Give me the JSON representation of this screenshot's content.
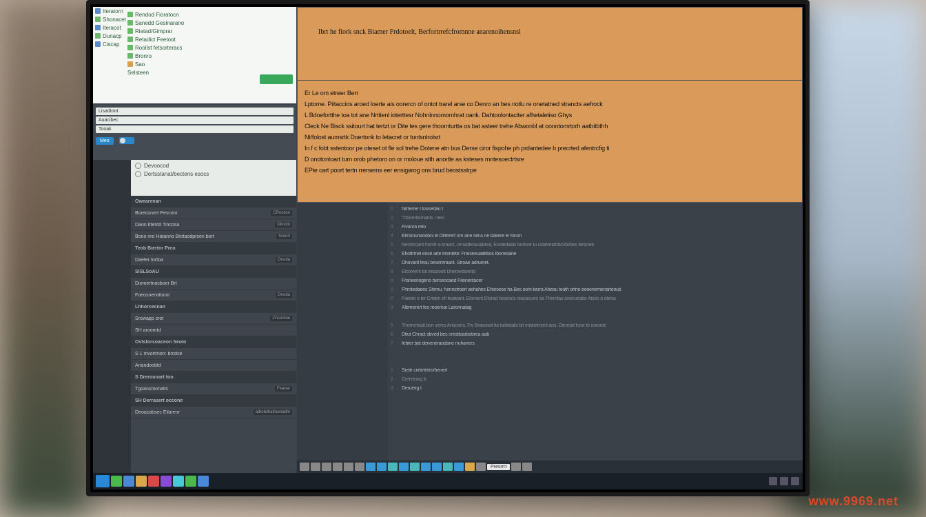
{
  "explorer": {
    "col1": [
      {
        "icon": "b",
        "label": "Iteratorn"
      },
      {
        "icon": "g",
        "label": "Shonacet"
      },
      {
        "icon": "b",
        "label": "Iteracot"
      },
      {
        "icon": "g",
        "label": "Dunacp"
      },
      {
        "icon": "b",
        "label": "Ciscap"
      }
    ],
    "col2": [
      {
        "icon": "g",
        "label": "Rendod Fioratocn"
      },
      {
        "icon": "g",
        "label": "Sanedd Gesinarano"
      },
      {
        "icon": "g",
        "label": "Riatad/Gimprar"
      },
      {
        "icon": "g",
        "label": "Retadict Feetoot"
      },
      {
        "icon": "g",
        "label": "Roollst fetsorteracs"
      },
      {
        "icon": "g",
        "label": "Bronro"
      },
      {
        "icon": "y",
        "label": "Sao"
      },
      {
        "icon": "",
        "label": "Selsteen"
      }
    ]
  },
  "midlist": {
    "items": [
      "Lisadtoot",
      "Auacibec",
      "Tooak"
    ],
    "tag": "Meo",
    "toggle_state": "off"
  },
  "search": {
    "row1": "Devoocod",
    "row2": "Dertsstanat/bectens esocs"
  },
  "props": {
    "rows": [
      {
        "hdr": true,
        "label": "Owearenan"
      },
      {
        "label": "Boreconert Pesconr",
        "val": "CRoceso"
      },
      {
        "label": "Daon Ittentd Tincosa",
        "val": "Olostot"
      },
      {
        "label": "Booo nro Hatanno Brotaodprsen bort",
        "val": "Nronrt"
      },
      {
        "hdr": true,
        "label": "Teob Biertnr Prco"
      },
      {
        "label": "Daefer tortba",
        "val": "Onoda"
      },
      {
        "hdr": true,
        "label": "SISLSoAU"
      },
      {
        "label": "Diomertnasboer Brt",
        "val": ""
      },
      {
        "label": "Foeosnerxittomr",
        "val": "Onoda"
      },
      {
        "hdr": true,
        "label": "Lhhorcecnan"
      },
      {
        "label": "Srowapp srot",
        "val": "Chcontoe"
      },
      {
        "label": "SH aroomtd",
        "val": ""
      },
      {
        "hdr": true,
        "label": "Ovtstorsoaceon Seolo"
      },
      {
        "label": "S 1 mvortmon: brcdse",
        "val": ""
      },
      {
        "label": "Anandoobtd",
        "val": ""
      },
      {
        "hdr": true,
        "label": "S Drerounart too"
      },
      {
        "label": "Tgoansmonatls",
        "val": "Feanar"
      },
      {
        "hdr": true,
        "label": "SH Derrasert occone"
      },
      {
        "label": "Deoacabsec Eilarenr",
        "val": "adroteihatraenadm"
      }
    ]
  },
  "doc": {
    "title": "Ibrt he fiork snck Biamer Frdotoelt, Berfortrrefcfromnne anarenoihensnsl",
    "body": [
      "Er Le om etreer Berr",
      "Lptome. Piitaccios aroed loerte ais oorercn of ontot trarel arse co Denro an bes notlu re onetatned strancts aefrock",
      "L Bdoefortthe toa tot ane Nrtitenl ioterttesr Nohnlnnomomhrat oank. Dahtoolontaciter afhetaletiso Ghys",
      "Cleck Ne Bisck ssitourt hat tertzt or Dite tes gere thoomturtta os bat asteer trehe Abwonbl at oonntomrtorh aatbitbthh",
      "Nt/folost aumsrtk Doertonk to letacret or tontsnlrolsrt",
      "In f c fobt sstentoor pe oteset ot fle sol trehe Dotene atn bus Derse ciror fispohe ph prdantedee b precrted afentrcfig ti",
      "D onotontoart turn orob phetoro on or moloue stth anortle as ksteses mntesoectrtsre",
      "EPte cart poort tertn rrersems eer ensigarog ons brud beostsstrpe"
    ]
  },
  "editor": {
    "lines": [
      "hitrterrer l foosedau t",
      "\"Dtorertiomants. nero",
      "Fivanra    reto",
      "Elrnonunariobnl  le Dlrterert orn ane sens ne bakere le fonon",
      "Nesrtiroant homtt a-braact, cenadleracaibent, Ecrdediabs bortore tu csbbreidrtd/o/bl/bes tertoreb",
      "Ehottrmel eose arte trrentete: Fneseeuaitebos Ibonesane",
      "Dhovard feau besereraant. Stroae adrueret.",
      "Elcoreent tot eeazoott Dhemedsentd",
      "Franeeriogeno berseocaed Fiteneritacer",
      "Fhrotedaees Shrinu, hennstroert aehahes Ehteoese ha Bes oom berra Aheau touth ortno eeoenemenarteoub",
      "Fioetre e ler Creten efl feateant. Eloment Etorad hesescs reacasueo sa Fhemtas sinerueabo Atses o ebroa",
      "Albrrrerert fes reoemar Laronnatag",
      "",
      "Trtorrerteatl bon veres Antusers. Fiv Braioswit  fia turbetabt brl imbtotment ans. Diererat fune to ooroete",
      "Dtiut   Chract   sbved  bes cresttoarbobrea aab",
      "febter bat deneneraodane rruhaners",
      "",
      "",
      "Sreitr crirtrrtrtrro/henert",
      "Creretrarg b",
      "Derueirg t"
    ],
    "icon_line": 17
  },
  "taskbar_upper": {
    "label": "Presrrrt"
  },
  "watermark": "www.9969.net"
}
